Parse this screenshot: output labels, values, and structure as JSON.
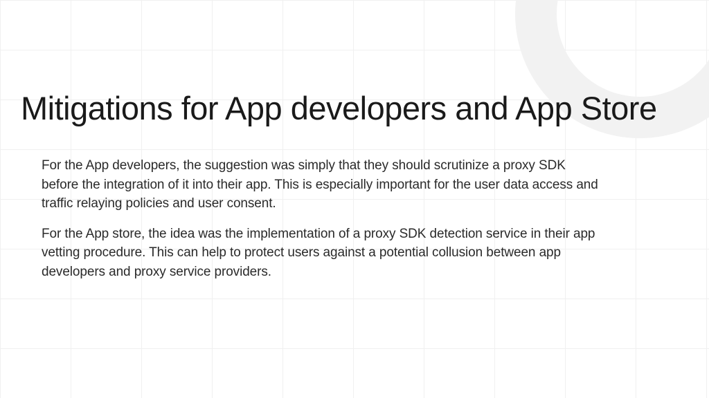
{
  "slide": {
    "title": "Mitigations for App developers and App Store",
    "paragraphs": [
      "For the App developers, the suggestion was simply that they should scrutinize a proxy SDK before the integration of it into their app. This is especially important for the user data access and traffic relaying policies and user consent.",
      "For the App store, the idea was the implementation of a proxy SDK detection service in their app vetting procedure. This can help to protect users against a potential collusion between app developers and proxy service providers."
    ]
  }
}
